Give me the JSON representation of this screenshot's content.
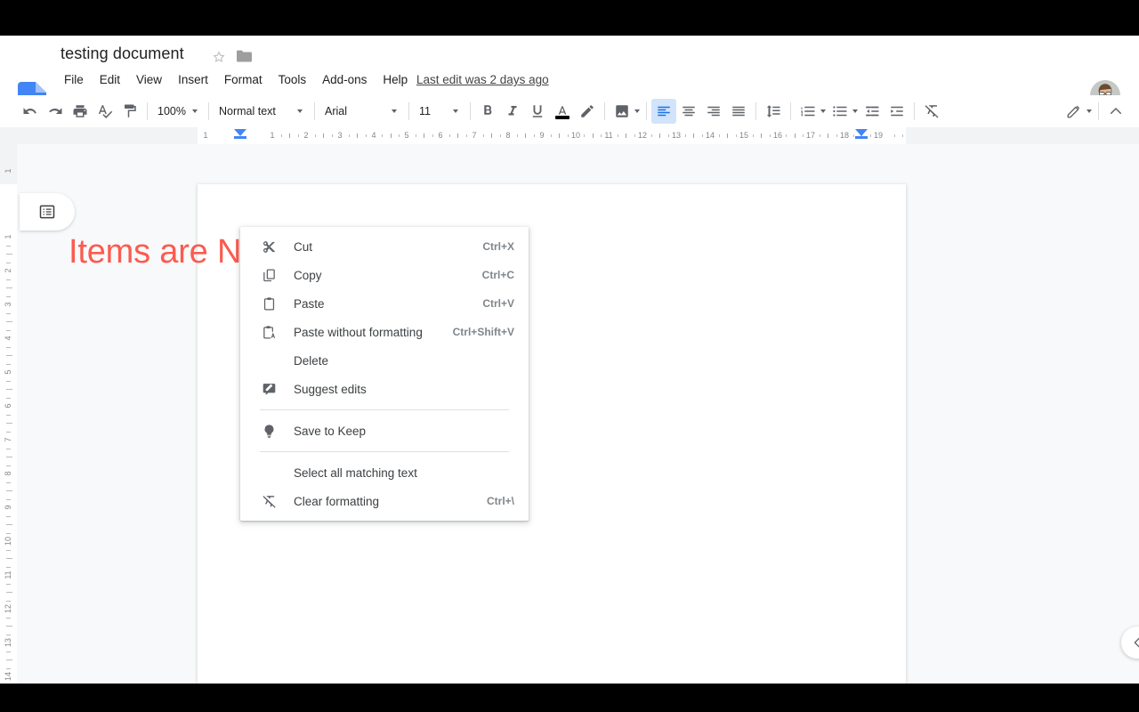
{
  "app": {
    "product": "Google Docs",
    "doc_title": "testing document",
    "last_edit": "Last edit was 2 days ago",
    "accent_color": "#4285f4",
    "heading_color": "#fb5b50"
  },
  "title_actions": [
    {
      "name": "star-icon",
      "label": "Star"
    },
    {
      "name": "folder-icon",
      "label": "Move to folder"
    }
  ],
  "menubar": {
    "items": [
      {
        "label": "File"
      },
      {
        "label": "Edit"
      },
      {
        "label": "View"
      },
      {
        "label": "Insert"
      },
      {
        "label": "Format"
      },
      {
        "label": "Tools"
      },
      {
        "label": "Add-ons"
      },
      {
        "label": "Help"
      }
    ]
  },
  "toolbar": {
    "undo": "Undo",
    "redo": "Redo",
    "print": "Print",
    "spelling": "Spelling and grammar check",
    "paint_format": "Paint format",
    "zoom_value": "100%",
    "style_value": "Normal text",
    "font_value": "Arial",
    "size_value": "11",
    "bold": "Bold",
    "italic": "Italic",
    "underline": "Underline",
    "text_color": "Text color",
    "highlight_color": "Highlight color",
    "insert_image": "Insert image",
    "align_left": "Left align",
    "align_center": "Center align",
    "align_right": "Right align",
    "align_justify": "Justify",
    "line_spacing": "Line spacing",
    "numbered_list": "Numbered list",
    "bulleted_list": "Bulleted list",
    "decrease_indent": "Decrease indent",
    "increase_indent": "Increase indent",
    "clear_formatting": "Clear formatting",
    "editing_mode": "Editing mode",
    "hide_menus": "Hide the menus"
  },
  "document": {
    "heading": "Items are Now Removed",
    "outline_button": "Show document outline",
    "collapse_button": "Hide",
    "zoom_percent": "100%"
  },
  "ruler": {
    "h_numbers": [
      "1",
      "1",
      "2",
      "3",
      "4",
      "5",
      "6",
      "7",
      "8",
      "9",
      "10",
      "11",
      "12",
      "13",
      "14",
      "15",
      "16",
      "17",
      "18",
      "19"
    ],
    "v_numbers": [
      "1",
      "1",
      "2",
      "3",
      "4",
      "5",
      "6",
      "7",
      "8",
      "9",
      "10",
      "11",
      "12",
      "13",
      "14"
    ]
  },
  "context_menu": {
    "items": [
      {
        "type": "item",
        "icon": "cut-icon",
        "label": "Cut",
        "shortcut": "Ctrl+X"
      },
      {
        "type": "item",
        "icon": "copy-icon",
        "label": "Copy",
        "shortcut": "Ctrl+C"
      },
      {
        "type": "item",
        "icon": "paste-icon",
        "label": "Paste",
        "shortcut": "Ctrl+V"
      },
      {
        "type": "item",
        "icon": "paste-plain-icon",
        "label": "Paste without formatting",
        "shortcut": "Ctrl+Shift+V"
      },
      {
        "type": "item",
        "icon": "",
        "label": "Delete",
        "shortcut": ""
      },
      {
        "type": "item",
        "icon": "suggest-edits-icon",
        "label": "Suggest edits",
        "shortcut": ""
      },
      {
        "type": "divider"
      },
      {
        "type": "item",
        "icon": "keep-bulb-icon",
        "label": "Save to Keep",
        "shortcut": ""
      },
      {
        "type": "divider"
      },
      {
        "type": "item",
        "icon": "",
        "label": "Select all matching text",
        "shortcut": ""
      },
      {
        "type": "item",
        "icon": "clear-formatting-icon",
        "label": "Clear formatting",
        "shortcut": "Ctrl+\\"
      }
    ]
  }
}
